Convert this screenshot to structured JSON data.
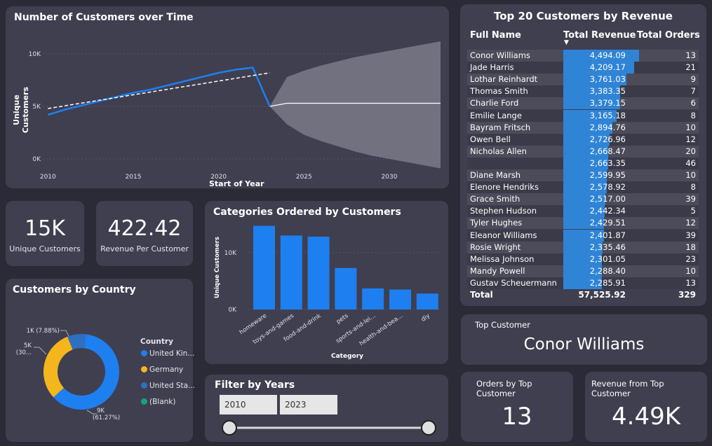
{
  "line_card": {
    "title": "Number of Customers over Time",
    "y_label": "Unique Customers",
    "x_label": "Start of Year",
    "y_ticks": [
      "10K",
      "5K",
      "0K"
    ],
    "x_ticks": [
      "2010",
      "2015",
      "2020",
      "2025",
      "2030"
    ]
  },
  "kpis": {
    "unique_customers": {
      "value": "15K",
      "label": "Unique Customers"
    },
    "revenue_per_customer": {
      "value": "422.42",
      "label": "Revenue Per Customer"
    }
  },
  "categories_card": {
    "title": "Categories Ordered by Customers",
    "y_label": "Unique Customers",
    "x_label": "Category",
    "y_ticks": [
      "10K",
      "0K"
    ],
    "tick_labels": [
      "homeware",
      "toys-and-games",
      "food-and-drink",
      "pets",
      "sports-and-lei...",
      "health-and-bea...",
      "diy"
    ]
  },
  "country_card": {
    "title": "Customers by Country",
    "legend_title": "Country",
    "legend": [
      {
        "label": "United Kin...",
        "color": "#1e7ff0"
      },
      {
        "label": "Germany",
        "color": "#f5b51c"
      },
      {
        "label": "United Sta...",
        "color": "#2f6fbf"
      },
      {
        "label": "(Blank)",
        "color": "#1aa37a"
      }
    ],
    "labels": {
      "uk_value": "9K",
      "uk_pct": "(61.27%)",
      "de_value": "5K",
      "de_pct": "(30...",
      "us_label": "1K (7.88%)"
    }
  },
  "top20": {
    "title": "Top 20 Customers by Revenue",
    "columns": [
      "Full Name",
      "Total Revenue",
      "Total Orders"
    ],
    "rows": [
      {
        "name": "Conor Williams",
        "revenue": "4,494.09",
        "orders": "13"
      },
      {
        "name": "Jade Harris",
        "revenue": "4,209.17",
        "orders": "21"
      },
      {
        "name": "Lothar Reinhardt",
        "revenue": "3,761.03",
        "orders": "9"
      },
      {
        "name": "Thomas Smith",
        "revenue": "3,383.35",
        "orders": "7"
      },
      {
        "name": "Charlie Ford",
        "revenue": "3,379.15",
        "orders": "6"
      },
      {
        "name": "Emilie Lange",
        "revenue": "3,165.18",
        "orders": "8"
      },
      {
        "name": "Bayram Fritsch",
        "revenue": "2,894.76",
        "orders": "10"
      },
      {
        "name": "Owen Bell",
        "revenue": "2,726.96",
        "orders": "12"
      },
      {
        "name": "Nicholas Allen",
        "revenue": "2,668.47",
        "orders": "20"
      },
      {
        "name": "",
        "revenue": "2,663.35",
        "orders": "46"
      },
      {
        "name": "Diane Marsh",
        "revenue": "2,599.95",
        "orders": "10"
      },
      {
        "name": "Elenore Hendriks",
        "revenue": "2,578.92",
        "orders": "8"
      },
      {
        "name": "Grace Smith",
        "revenue": "2,517.00",
        "orders": "39"
      },
      {
        "name": "Stephen Hudson",
        "revenue": "2,442.34",
        "orders": "5"
      },
      {
        "name": "Tyler Hughes",
        "revenue": "2,429.51",
        "orders": "12"
      },
      {
        "name": "Eleanor Williams",
        "revenue": "2,401.87",
        "orders": "39"
      },
      {
        "name": "Rosie Wright",
        "revenue": "2,335.46",
        "orders": "18"
      },
      {
        "name": "Melissa Johnson",
        "revenue": "2,301.05",
        "orders": "23"
      },
      {
        "name": "Mandy Powell",
        "revenue": "2,288.40",
        "orders": "10"
      },
      {
        "name": "Gustav Scheuermann",
        "revenue": "2,285.91",
        "orders": "13"
      }
    ],
    "total_label": "Total",
    "total_revenue": "57,525.92",
    "total_orders": "329"
  },
  "top_customer": {
    "label": "Top Customer",
    "name": "Conor Williams"
  },
  "orders_by_top": {
    "label1": "Orders by Top",
    "label2": "Customer",
    "value": "13"
  },
  "revenue_from_top": {
    "label1": "Revenue from Top",
    "label2": "Customer",
    "value": "4.49K"
  },
  "filter": {
    "title": "Filter by Years",
    "start": "2010",
    "end": "2023"
  },
  "chart_data": [
    {
      "type": "line",
      "title": "Number of Customers over Time",
      "xlabel": "Start of Year",
      "ylabel": "Unique Customers",
      "xlim": [
        2009.7,
        2033
      ],
      "ylim": [
        -2000,
        12000
      ],
      "series": [
        {
          "x": [
            2010,
            2011,
            2012,
            2013,
            2014,
            2015,
            2016,
            2017,
            2018,
            2019,
            2020,
            2021,
            2022,
            2023
          ],
          "values": [
            4200,
            4700,
            5100,
            5500,
            5900,
            6300,
            6600,
            7000,
            7400,
            7800,
            8200,
            8500,
            8700,
            5000
          ]
        }
      ],
      "trend": {
        "x": [
          2010,
          2023
        ],
        "values": [
          4800,
          8200
        ]
      },
      "forecast": {
        "x": [
          2023,
          2024,
          2025,
          2026,
          2027,
          2028,
          2029,
          2030,
          2031,
          2032,
          2033
        ],
        "values": [
          5000,
          5300,
          5300,
          5300,
          5300,
          5300,
          5300,
          5300,
          5300,
          5300,
          5300
        ],
        "upper": [
          5000,
          7800,
          8400,
          8900,
          9300,
          9700,
          10000,
          10300,
          10600,
          10900,
          11200
        ],
        "lower": [
          5000,
          3300,
          2300,
          1700,
          1200,
          700,
          300,
          0,
          -300,
          -600,
          -900
        ]
      }
    },
    {
      "type": "bar",
      "title": "Categories Ordered by Customers",
      "xlabel": "Category",
      "ylabel": "Unique Customers",
      "categories": [
        "homeware",
        "toys-and-games",
        "food-and-drink",
        "pets",
        "sports-and-lei...",
        "health-and-bea...",
        "diy"
      ],
      "values": [
        14700,
        13000,
        12800,
        7300,
        3700,
        3500,
        2800
      ],
      "ylim": [
        0,
        16000
      ]
    },
    {
      "type": "pie",
      "title": "Customers by Country",
      "categories": [
        "United Kin...",
        "Germany",
        "United Sta...",
        "(Blank)"
      ],
      "values": [
        61.27,
        30.85,
        7.88,
        0.0
      ]
    }
  ]
}
